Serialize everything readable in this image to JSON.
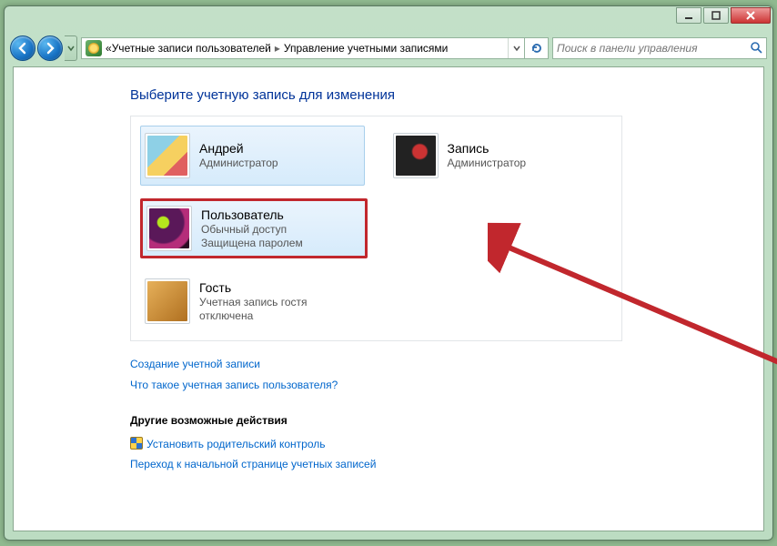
{
  "address": {
    "crumb1": "Учетные записи пользователей",
    "crumb2": "Управление учетными записями"
  },
  "search": {
    "placeholder": "Поиск в панели управления"
  },
  "heading": "Выберите учетную запись для изменения",
  "accounts": {
    "andrey": {
      "name": "Андрей",
      "role": "Администратор"
    },
    "zapis": {
      "name": "Запись",
      "role": "Администратор"
    },
    "user": {
      "name": "Пользователь",
      "role": "Обычный доступ",
      "extra": "Защищена паролем"
    },
    "guest": {
      "name": "Гость",
      "role": "Учетная запись гостя отключена"
    }
  },
  "links": {
    "create": "Создание учетной записи",
    "whatis": "Что такое учетная запись пользователя?"
  },
  "other": {
    "header": "Другие возможные действия",
    "parental": "Установить родительский контроль",
    "gohome": "Переход к начальной странице учетных записей"
  }
}
